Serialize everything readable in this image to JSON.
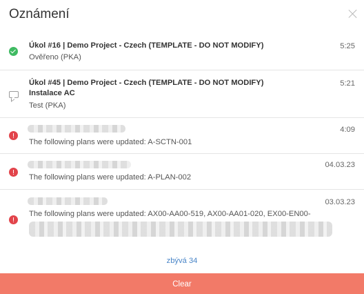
{
  "header": {
    "title": "Oznámení"
  },
  "notifications": [
    {
      "status": "success",
      "title": "Úkol #16 | Demo Project - Czech (TEMPLATE - DO NOT MODIFY)",
      "subtitle": "Ověřeno (PKA)",
      "time": "5:25"
    },
    {
      "status": "comment",
      "title": "Úkol #45 | Demo Project - Czech (TEMPLATE - DO NOT MODIFY)",
      "title2": "Instalace AC",
      "subtitle": "Test (PKA)",
      "time": "5:21"
    },
    {
      "status": "error",
      "subtitle": "The following plans were updated: A-SCTN-001",
      "time": "4:09"
    },
    {
      "status": "error",
      "subtitle": "The following plans were updated: A-PLAN-002",
      "time": "04.03.23"
    },
    {
      "status": "error",
      "subtitle": "The following plans were updated: AX00-AA00-519, AX00-AA01-020, EX00-EN00-",
      "time": "03.03.23"
    }
  ],
  "more_label": "zbývá 34",
  "clear_label": "Clear",
  "colors": {
    "accent": "#f27a68",
    "link": "#4a86c8",
    "success": "#3fba62",
    "error": "#e2444b"
  }
}
